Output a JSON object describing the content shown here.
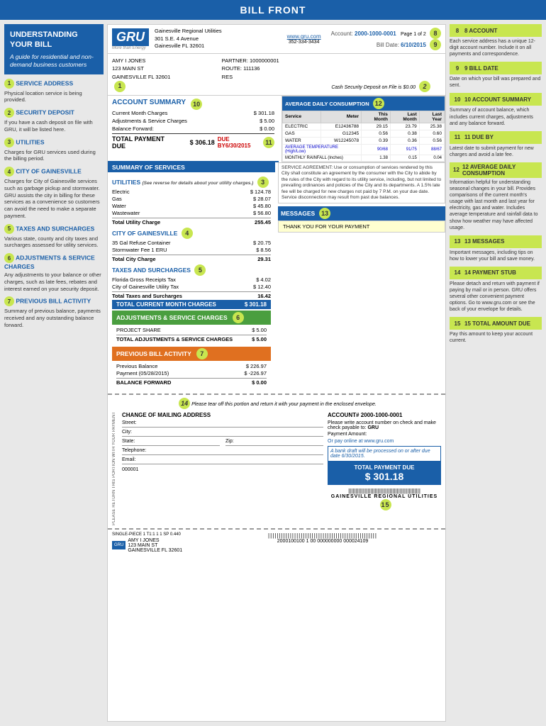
{
  "header": {
    "title": "BILL FRONT"
  },
  "left_sidebar": {
    "title": "UNDERSTANDING YOUR BILL",
    "subtitle": "A guide for residential and non-demand business customers",
    "items": [
      {
        "number": "1",
        "title": "SERVICE ADDRESS",
        "text": "Physical location service is being provided."
      },
      {
        "number": "2",
        "title": "SECURITY DEPOSIT",
        "text": "If you have a cash deposit on file with GRU, it will be listed here."
      },
      {
        "number": "3",
        "title": "UTILITIES",
        "text": "Charges for GRU services used during the billing period."
      },
      {
        "number": "4",
        "title": "CITY OF GAINESVILLE",
        "text": "Charges for City of Gainesville services such as garbage pickup and stormwater. GRU assists the city in billing for these services as a convenience so customers can avoid the need to make a separate payment."
      },
      {
        "number": "5",
        "title": "TAXES AND SURCHARGES",
        "text": "Various state, county and city taxes and surcharges assessed for utility services."
      },
      {
        "number": "6",
        "title": "ADJUSTMENTS & SERVICE CHARGES",
        "text": "Any adjustments to your balance or other charges, such as late fees, rebates and interest earned on your security deposit."
      },
      {
        "number": "7",
        "title": "PREVIOUS BILL ACTIVITY",
        "text": "Summary of previous balance, payments received and any outstanding balance forward."
      }
    ]
  },
  "gru": {
    "logo": "GRU",
    "tagline": "More than Energy",
    "company": "Gainesville Regional Utilities",
    "address1": "301 S.E. 4 Avenue",
    "address2": "Gainesville FL 32601",
    "website": "www.gru.com",
    "phone": "352-334-3434"
  },
  "account_header": {
    "account_label": "Account:",
    "account_number": "2000-1000-0001",
    "page_label": "Page 1 of 2",
    "bill_date_label": "Bill Date:",
    "bill_date": "6/10/2015"
  },
  "customer": {
    "name": "AMY I JONES",
    "address1": "123 MAIN ST",
    "address2": "GAINESVILLE FL 32601",
    "partner_label": "PARTNER:",
    "partner_number": "1000000001",
    "route_label": "ROUTE:",
    "route_number": "111136",
    "res_label": "RES",
    "security_deposit": "Cash Security Deposit on File is $0.00"
  },
  "account_summary": {
    "title": "ACCOUNT SUMMARY",
    "rows": [
      {
        "label": "Current Month Charges",
        "symbol": "$",
        "value": "301.18"
      },
      {
        "label": "Adjustments & Service Charges",
        "symbol": "$",
        "value": "5.00"
      },
      {
        "label": "Balance Forward:",
        "symbol": "$",
        "value": "0.00"
      }
    ],
    "total_label": "TOTAL PAYMENT DUE",
    "total_symbol": "$",
    "total_value": "306.18",
    "due_label": "DUE BY6/30/2015",
    "badge": "11"
  },
  "summary_of_services": {
    "title": "SUMMARY OF SERVICES",
    "utilities_title": "UTILITIES",
    "utilities_note": "(See reverse for details about your utility charges.)",
    "utilities_badge": "3",
    "utilities": [
      {
        "label": "Electric",
        "symbol": "$",
        "value": "124.78"
      },
      {
        "label": "Gas",
        "symbol": "$",
        "value": "28.07"
      },
      {
        "label": "Water",
        "symbol": "$",
        "value": "45.80"
      },
      {
        "label": "Wastewater",
        "symbol": "$",
        "value": "56.80"
      }
    ],
    "utilities_total_label": "Total Utility Charge",
    "utilities_total": "255.45",
    "city_title": "CITY OF GAINESVILLE",
    "city_badge": "4",
    "city_rows": [
      {
        "label": "35 Gal Refuse Container",
        "symbol": "$",
        "value": "20.75"
      },
      {
        "label": "Stormwater Fee 1 ERU",
        "symbol": "$",
        "value": "8.56"
      }
    ],
    "city_total_label": "Total City Charge",
    "city_total": "29.31",
    "taxes_title": "TAXES AND SURCHARGES",
    "taxes_badge": "5",
    "taxes_rows": [
      {
        "label": "Florida Gross Receipts Tax",
        "symbol": "$",
        "value": "4.02"
      },
      {
        "label": "City of Gainesville Utility Tax",
        "symbol": "$",
        "value": "12.40"
      }
    ],
    "taxes_total_label": "Total Taxes and Surcharges",
    "taxes_total": "16.42",
    "current_total_label": "TOTAL CURRENT MONTH CHARGES",
    "current_total_symbol": "$",
    "current_total": "301.18"
  },
  "adjustments": {
    "title": "ADJUSTMENTS & SERVICE CHARGES",
    "badge": "6",
    "rows": [
      {
        "label": "PROJECT SHARE",
        "symbol": "$",
        "value": "5.00"
      }
    ],
    "total_label": "TOTAL ADJUSTMENTS & SERVICE CHARGES",
    "total_symbol": "$",
    "total_value": "5.00"
  },
  "previous_activity": {
    "title": "PREVIOUS BILL ACTIVITY",
    "badge": "7",
    "rows": [
      {
        "label": "Previous Balance",
        "symbol": "$",
        "value": "226.97"
      },
      {
        "label": "Payment (05/28/2015)",
        "symbol": "$",
        "value": "-226.97"
      }
    ],
    "total_label": "BALANCE FORWARD",
    "total_symbol": "$",
    "total_value": "0.00"
  },
  "daily_consumption": {
    "title": "AVERAGE DAILY CONSUMPTION",
    "badge": "12",
    "headers": [
      "Service",
      "Meter",
      "This Month",
      "Last Month",
      "Last Year"
    ],
    "rows": [
      {
        "service": "ELECTRIC",
        "meter": "E12436788",
        "this_month": "29.15",
        "last_month": "23.79",
        "last_year": "25.38"
      },
      {
        "service": "GAS",
        "meter": "G12345",
        "this_month": "0.56",
        "last_month": "0.38",
        "last_year": "0.60"
      },
      {
        "service": "WATER",
        "meter": "W12245078",
        "this_month": "0.39",
        "last_month": "0.36",
        "last_year": "0.56"
      }
    ],
    "avg_temp_label": "AVERAGE TEMPERATURE (High/Low)",
    "avg_temp_this": "90/68",
    "avg_temp_last": "91/75",
    "avg_temp_year": "88/67",
    "rainfall_label": "MONTHLY RAINFALL (Inches)",
    "rainfall_this": "1.38",
    "rainfall_last": "0.15",
    "rainfall_year": "0.04"
  },
  "service_agreement": {
    "text": "SERVICE AGREEMENT: Use or consumption of services rendered by this City shall constitute an agreement by the consumer with the City to abide by the rules of the City with regard to its utility service, including, but not limited to prevailing ordinances and policies of the City and its departments. A 1.5% late fee will be charged for new charges not paid by 7 P.M. on your due date. Service disconnection may result from past due balances."
  },
  "messages": {
    "title": "MESSAGES",
    "badge": "13",
    "text": "THANK YOU FOR YOUR PAYMENT"
  },
  "payment_stub": {
    "badge": "14",
    "instructions": "Please tear off this portion and return it with your payment in the enclosed envelope.",
    "account_prefix": "ACCOUNT#",
    "account_number": "2000-1000-0001",
    "address_title": "CHANGE OF MAILING ADDRESS",
    "fields": [
      "Street:",
      "City:",
      "State:",
      "Zip:",
      "Telephone:",
      "Email:"
    ],
    "payable_text": "Please write account number on check and make check payable to:",
    "payable_to": "GRU",
    "payment_amount_label": "Payment Amount:",
    "or_pay_label": "Or pay online at www.gru.com",
    "bank_draft": "A bank draft will be processed on or after due date 6/30/2015.",
    "total_payment_label": "TOTAL PAYMENT DUE",
    "total_amount": "$ 301.18",
    "barcode_text": "GAINESVILLE REGIONAL UTILITIES",
    "barcode_numbers": "||||||||||||||||||||||||||||||||||||||||||||||||||",
    "badge15": "15"
  },
  "mailing": {
    "return_number": "000001",
    "name": "AMY I JONES",
    "address1": "123 MAIN ST",
    "address2": "GAINESVILLE FL 32601",
    "bottom_barcode": "2000100100 1 00 000000000 000024109",
    "mail_class": "SINGLE-PIECE 1 T1:1   1 1 SP 0.440"
  },
  "right_sidebar": {
    "items": [
      {
        "number": "8",
        "title": "8 ACCOUNT",
        "text": "Each service address has a unique 12-digit account number. Include it on all payments and correspondence."
      },
      {
        "number": "9",
        "title": "9 BILL DATE",
        "text": "Date on which your bill was prepared and sent."
      },
      {
        "number": "10",
        "title": "10 ACCOUNT SUMMARY",
        "text": "Summary of account balance, which includes current charges, adjustments and any balance forward."
      },
      {
        "number": "11",
        "title": "11 DUE BY",
        "text": "Latest date to submit payment for new charges and avoid a late fee."
      },
      {
        "number": "12",
        "title": "12 AVERAGE DAILY CONSUMPTION",
        "text": "Information helpful for understanding seasonal changes in your bill. Provides comparisons of the current month's usage with last month and last year for electricity, gas and water. Includes average temperature and rainfall data to show how weather may have affected usage."
      },
      {
        "number": "13",
        "title": "13 MESSAGES",
        "text": "Important messages, including tips on how to lower your bill and save money."
      },
      {
        "number": "14",
        "title": "14 PAYMENT STUB",
        "text": "Please detach and return with payment if paying by mail or in person. GRU offers several other convenient payment options. Go to www.gru.com or see the back of your envelope for details."
      },
      {
        "number": "15",
        "title": "15 TOTAL AMOUNT DUE",
        "text": "Pay this amount to keep your account current."
      }
    ]
  }
}
